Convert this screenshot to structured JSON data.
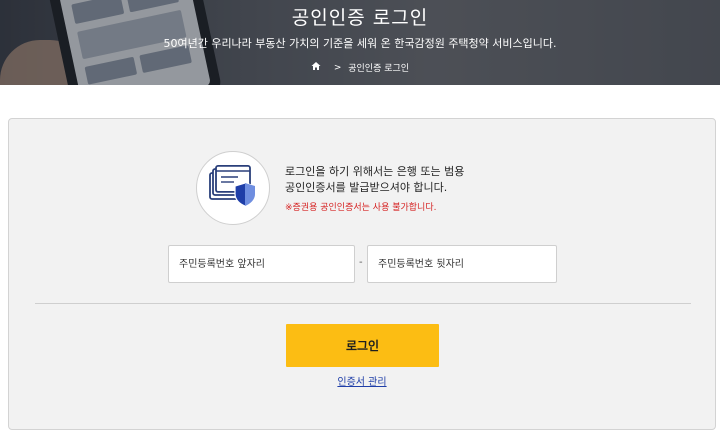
{
  "header": {
    "title": "공인인증 로그인",
    "subtitle": "50여년간 우리나라 부동산 가치의 기준을 세워 온 한국감정원 주택청약 서비스입니다.",
    "breadcrumb": {
      "separator": ">",
      "current": "공인인증 로그인"
    }
  },
  "login": {
    "info_line1": "로그인을 하기 위해서는 은행 또는 범용",
    "info_line2": "공인인증서를 발급받으셔야 합니다.",
    "warning": "※증권용 공인인증서는 사용 불가합니다.",
    "front_id_placeholder": "주민등록번호 앞자리",
    "back_id_placeholder": "주민등록번호 뒷자리",
    "id_separator": "-",
    "login_button": "로그인",
    "cert_manage_link": "인증서 관리"
  },
  "colors": {
    "button": "#fcbd13",
    "warning": "#d62424",
    "link": "#1f3ea8"
  },
  "icons": [
    "home-icon",
    "certificate-shield-icon"
  ]
}
